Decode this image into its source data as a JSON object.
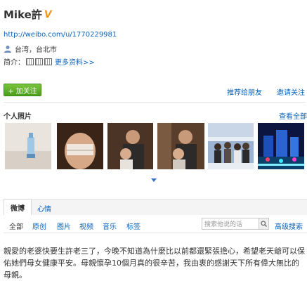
{
  "profile": {
    "name": "Mike許",
    "verified_icon": "v-badge-icon",
    "url": "http://weibo.com/u/1770229981",
    "location": "台湾，台北市",
    "intro_label": "简介：",
    "more_link": "更多资料>>"
  },
  "actions": {
    "follow_label": "+ 加关注",
    "recommend_label": "推荐给朋友",
    "invite_label": "邀请关注"
  },
  "photos": {
    "title": "个人照片",
    "view_all": "查看全部"
  },
  "tabs": [
    {
      "label": "微博",
      "active": true
    },
    {
      "label": "心情",
      "active": false
    }
  ],
  "filters": [
    "全部",
    "原创",
    "图片",
    "视频",
    "音乐",
    "标签"
  ],
  "search": {
    "placeholder": "搜索他说的话",
    "advanced_label": "高级搜索"
  },
  "post": {
    "text": "親愛的老婆快要生許老三了，今晚不知道為什麼比以前都還緊張擔心，希望老天爺可以保佑她們母女健康平安。母親懷孕10個月真的很辛苦，我由衷的感謝天下所有偉大無比的母親。"
  },
  "colors": {
    "link": "#0a63bd",
    "follow_button": "#5aab26",
    "verified": "#f2961c"
  }
}
